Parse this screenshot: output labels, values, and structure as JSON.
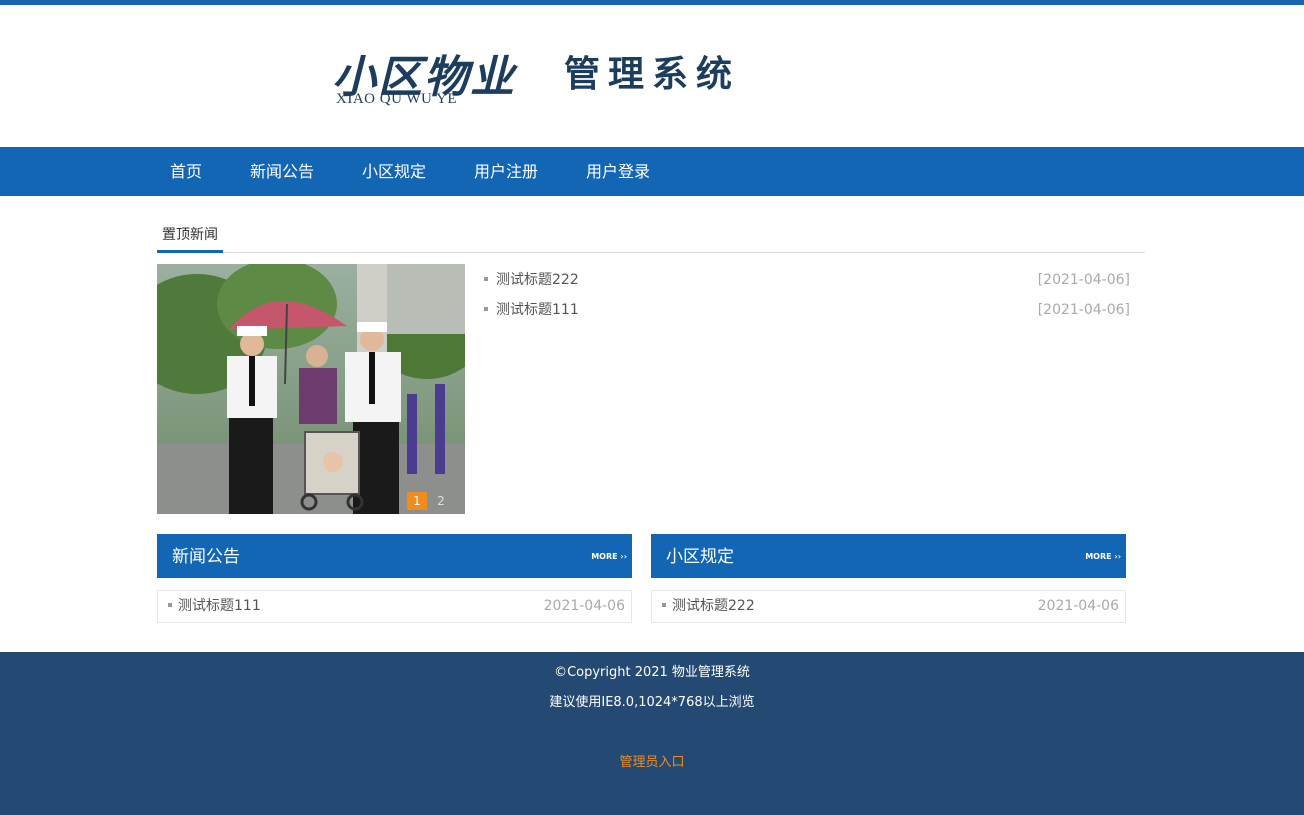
{
  "header": {
    "logo_cn": "小区物业",
    "logo_en": "XIAO QU WU YE",
    "logo_system": "管理系统"
  },
  "nav": {
    "items": [
      {
        "label": "首页"
      },
      {
        "label": "新闻公告"
      },
      {
        "label": "小区规定"
      },
      {
        "label": "用户注册"
      },
      {
        "label": "用户登录"
      }
    ]
  },
  "top_news": {
    "title": "置顶新闻",
    "slider": {
      "pages": [
        "1",
        "2"
      ],
      "current": "1"
    },
    "items": [
      {
        "title": "测试标题222",
        "date": "[2021-04-06]"
      },
      {
        "title": "测试标题111",
        "date": "[2021-04-06]"
      }
    ]
  },
  "news_box": {
    "title": "新闻公告",
    "more": "MORE",
    "items": [
      {
        "title": "测试标题111",
        "date": "2021-04-06"
      }
    ]
  },
  "rules_box": {
    "title": "小区规定",
    "more": "MORE",
    "items": [
      {
        "title": "测试标题222",
        "date": "2021-04-06"
      }
    ]
  },
  "footer": {
    "copyright": "©Copyright 2021 物业管理系统",
    "browser_tip": "建议使用IE8.0,1024*768以上浏览",
    "admin_link": "管理员入口"
  },
  "colors": {
    "primary": "#1266b3",
    "footer": "#244a73",
    "accent": "#f08c1e"
  }
}
